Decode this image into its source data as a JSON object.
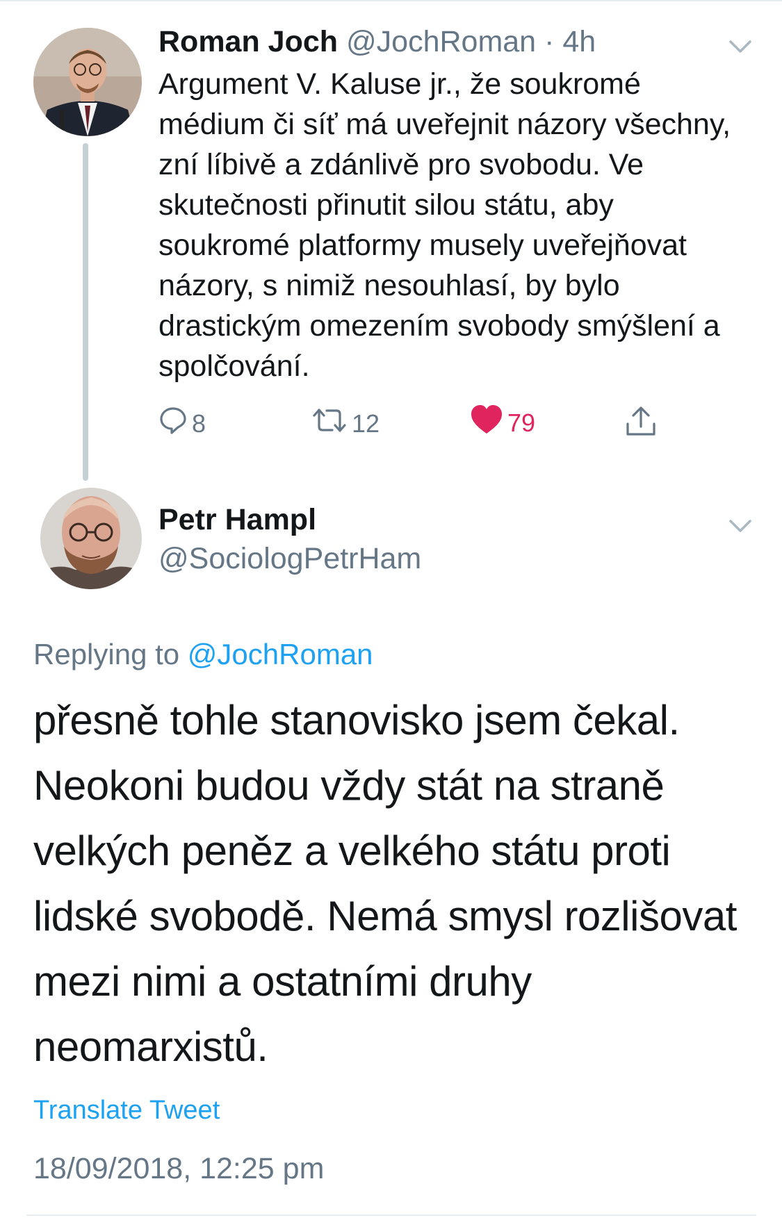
{
  "tweet1": {
    "author_name": "Roman Joch",
    "handle": "@JochRoman",
    "separator": "·",
    "time": "4h",
    "text": "Argument V. Kaluse jr., že soukromé médium či síť má uveřejnit názory všechny, zní líbivě a zdánlivě pro svobodu. Ve skutečnosti přinutit silou státu, aby soukromé platformy musely uveřejňovat názory, s nimiž nesouhlasí, by bylo drastickým omezením svobody smýšlení a spolčování.",
    "actions": {
      "reply_icon": "reply-icon",
      "reply_count": "8",
      "retweet_icon": "retweet-icon",
      "retweet_count": "12",
      "like_icon": "heart-icon",
      "like_count": "79",
      "share_icon": "share-icon"
    },
    "menu_icon": "chevron-down-icon"
  },
  "tweet2": {
    "author_name": "Petr Hampl",
    "handle": "@SociologPetrHam",
    "replying_prefix": "Replying to",
    "replying_to": "@JochRoman",
    "text": "přesně tohle stanovisko jsem čekal. Neokoni budou vždy stát na straně velkých peněz a velkého státu proti lidské svobodě. Nemá smysl rozlišovat mezi nimi a ostatními druhy neomarxistů.",
    "translate_label": "Translate Tweet",
    "timestamp": "18/09/2018, 12:25 pm",
    "menu_icon": "chevron-down-icon"
  },
  "colors": {
    "text": "#14171a",
    "secondary": "#657786",
    "link": "#1da1f2",
    "like": "#e0245e",
    "thread_line": "#c4cfd6"
  }
}
